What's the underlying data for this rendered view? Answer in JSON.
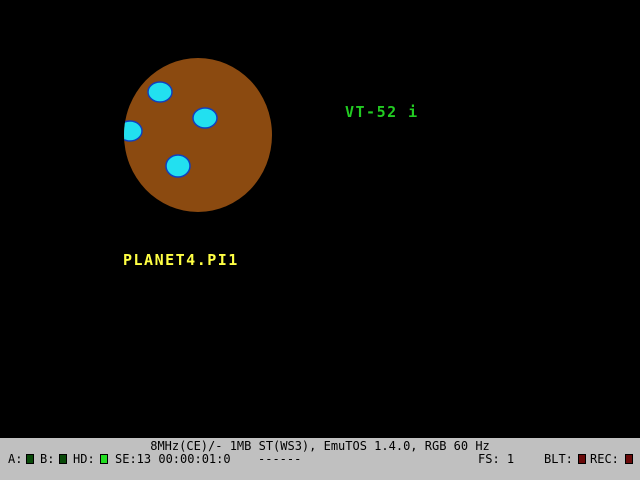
{
  "screen": {
    "vt52_text": "VT-52 i",
    "vt52_color": "#22cc22",
    "filename_text": "PLANET4.PI1",
    "filename_color": "#ffff44",
    "planet": {
      "body_color": "#8b4a10",
      "spot_color": "#22e0f0",
      "spot_outline_color": "#1040c0"
    }
  },
  "statusbar": {
    "machine_info": "8MHz(CE)/- 1MB ST(WS3), EmuTOS 1.4.0, RGB 60 Hz",
    "drive_a_label": "A:",
    "drive_b_label": "B:",
    "hd_label": "HD:",
    "se_info": "SE:13 00:00:01:0",
    "dashes": "------",
    "fs_label": "FS: 1",
    "blt_label": "BLT:",
    "rec_label": "REC:",
    "led_colors": {
      "drive_a": "#0a4a0a",
      "drive_b": "#0a4a0a",
      "hd": "#22dd22",
      "blt": "#6a0a0a",
      "rec": "#6a0a0a"
    }
  }
}
